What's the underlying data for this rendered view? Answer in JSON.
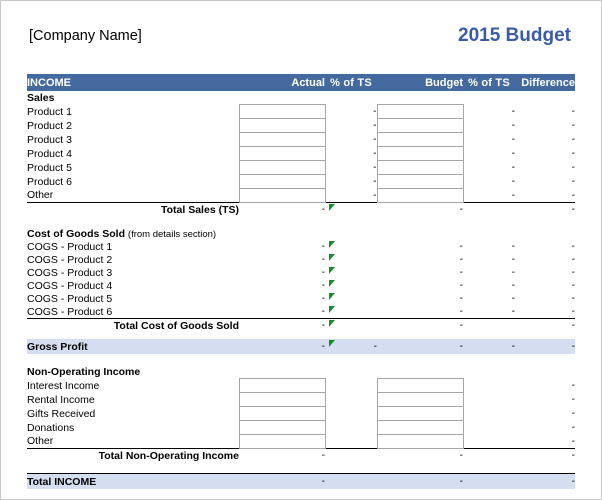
{
  "header": {
    "company_name": "[Company Name]",
    "doc_title": "2015 Budget"
  },
  "colors": {
    "header_blue": "#44699E",
    "title_blue": "#3A5BA8",
    "band_blue": "#D5DEF0",
    "marker_green": "#148F2F"
  },
  "columns": {
    "income": "INCOME",
    "actual": "Actual",
    "pct_of_ts_1": "% of TS",
    "budget": "Budget",
    "pct_of_ts_2": "% of TS",
    "difference": "Difference"
  },
  "dash": "-",
  "sections": {
    "sales": {
      "heading": "Sales",
      "rows": [
        "Product 1",
        "Product 2",
        "Product 3",
        "Product 4",
        "Product 5",
        "Product 6",
        "Other"
      ],
      "total_label": "Total Sales (TS)",
      "total_values": {
        "actual": "-",
        "pct1": "",
        "budget": "-",
        "pct2": "",
        "difference": "-"
      }
    },
    "cogs": {
      "heading": "Cost of Goods Sold",
      "heading_note": "(from details section)",
      "rows": [
        "COGS - Product 1",
        "COGS - Product 2",
        "COGS - Product 3",
        "COGS - Product 4",
        "COGS - Product 5",
        "COGS - Product 6"
      ],
      "total_label": "Total Cost of Goods Sold",
      "total_values": {
        "actual": "-",
        "budget": "-",
        "difference": "-"
      }
    },
    "gross_profit": {
      "label": "Gross Profit",
      "values": {
        "actual": "-",
        "pct1": "-",
        "budget": "-",
        "pct2": "-",
        "difference": "-"
      }
    },
    "non_operating": {
      "heading": "Non-Operating Income",
      "rows": [
        "Interest Income",
        "Rental Income",
        "Gifts Received",
        "Donations",
        "Other"
      ],
      "total_label": "Total Non-Operating Income",
      "total_values": {
        "actual": "-",
        "budget": "-",
        "difference": "-"
      }
    },
    "total_income": {
      "label": "Total INCOME",
      "values": {
        "actual": "-",
        "budget": "-",
        "difference": "-"
      }
    }
  }
}
